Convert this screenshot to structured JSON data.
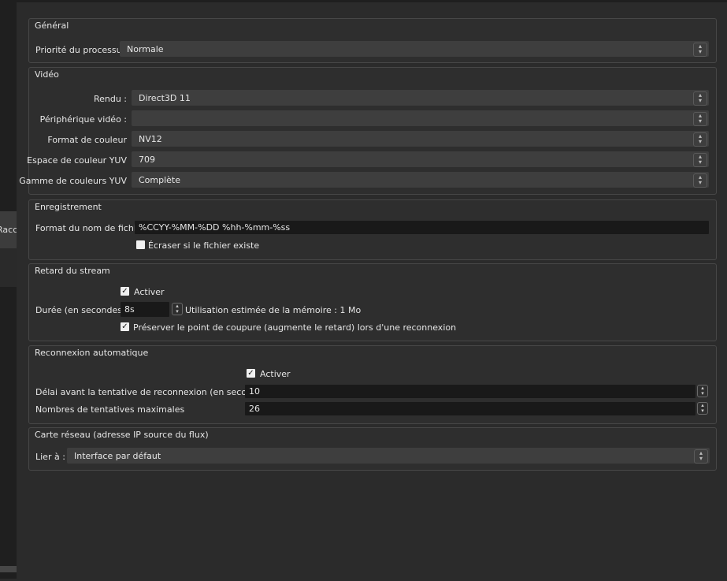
{
  "sidebar": {
    "selected_label": "Raccourcis clavier"
  },
  "general": {
    "title": "Général",
    "priority_label": "Priorité du processus",
    "priority_value": "Normale"
  },
  "video": {
    "title": "Vidéo",
    "renderer_label": "Rendu :",
    "renderer_value": "Direct3D 11",
    "device_label": "Périphérique vidéo :",
    "device_value": "",
    "color_format_label": "Format de couleur",
    "color_format_value": "NV12",
    "yuv_space_label": "Espace de couleur YUV",
    "yuv_space_value": "709",
    "yuv_range_label": "Gamme de couleurs YUV",
    "yuv_range_value": "Complète"
  },
  "recording": {
    "title": "Enregistrement",
    "filename_label": "Format du nom de fichier",
    "filename_value": "%CCYY-%MM-%DD %hh-%mm-%ss",
    "overwrite_label": "Écraser si le fichier existe",
    "overwrite_checked": false
  },
  "stream_delay": {
    "title": "Retard du stream",
    "enable_label": "Activer",
    "enable_checked": true,
    "duration_label": "Durée (en secondes)",
    "duration_value": "8s",
    "memory_text": "Utilisation estimée de la mémoire : 1 Mo",
    "preserve_label": "Préserver le point de coupure (augmente le retard) lors d'une reconnexion",
    "preserve_checked": true
  },
  "reconnect": {
    "title": "Reconnexion automatique",
    "enable_label": "Activer",
    "enable_checked": true,
    "delay_label": "Délai avant la tentative de reconnexion (en secondes)",
    "delay_value": "10",
    "max_retries_label": "Nombres de tentatives maximales",
    "max_retries_value": "26"
  },
  "network": {
    "title": "Carte réseau (adresse IP source du flux)",
    "bind_label": "Lier à :",
    "bind_value": "Interface par défaut"
  },
  "icons": {
    "combo_arrows": "updown-chevron-icon",
    "checkbox_check": "check-icon"
  }
}
